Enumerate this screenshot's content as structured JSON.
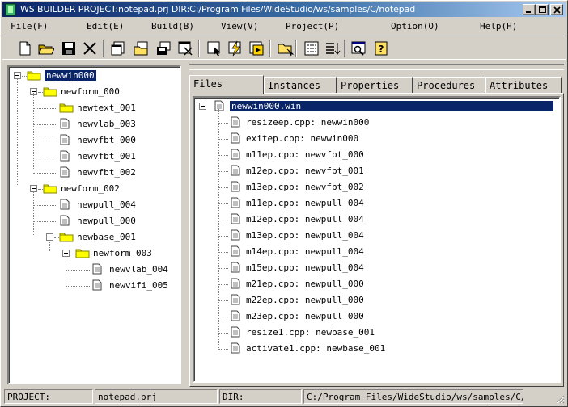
{
  "window": {
    "title": "WS BUILDER PROJECT:notepad.prj DIR:C:/Program Files/WideStudio/ws/samples/C/notepad"
  },
  "menu": [
    {
      "label": "File(F)"
    },
    {
      "label": "Edit(E)"
    },
    {
      "label": "Build(B)"
    },
    {
      "label": "View(V)"
    },
    {
      "label": "Project(P)"
    },
    {
      "label": "Option(O)"
    },
    {
      "label": "Help(H)"
    }
  ],
  "tree": {
    "items": [
      {
        "label": "newwin000",
        "type": "folder",
        "level": 0,
        "selected": true
      },
      {
        "label": "newform_000",
        "type": "folder",
        "level": 1
      },
      {
        "label": "newtext_001",
        "type": "folder",
        "level": 2
      },
      {
        "label": "newvlab_003",
        "type": "file",
        "level": 2
      },
      {
        "label": "newvfbt_000",
        "type": "file",
        "level": 2
      },
      {
        "label": "newvfbt_001",
        "type": "file",
        "level": 2
      },
      {
        "label": "newvfbt_002",
        "type": "file",
        "level": 2
      },
      {
        "label": "newform_002",
        "type": "folder",
        "level": 1
      },
      {
        "label": "newpull_004",
        "type": "file",
        "level": 2
      },
      {
        "label": "newpull_000",
        "type": "file",
        "level": 2
      },
      {
        "label": "newbase_001",
        "type": "folder",
        "level": 2
      },
      {
        "label": "newform_003",
        "type": "folder",
        "level": 3
      },
      {
        "label": "newvlab_004",
        "type": "file",
        "level": 4
      },
      {
        "label": "newvifi_005",
        "type": "file",
        "level": 4
      }
    ]
  },
  "tabs": [
    {
      "label": "Files",
      "active": true
    },
    {
      "label": "Instances"
    },
    {
      "label": "Properties"
    },
    {
      "label": "Procedures"
    },
    {
      "label": "Attributes"
    }
  ],
  "files": {
    "root": "newwin000.win",
    "items": [
      "resizeep.cpp: newwin000",
      "exitep.cpp: newwin000",
      "m11ep.cpp: newvfbt_000",
      "m12ep.cpp: newvfbt_001",
      "m13ep.cpp: newvfbt_002",
      "m11ep.cpp: newpull_004",
      "m12ep.cpp: newpull_004",
      "m13ep.cpp: newpull_004",
      "m14ep.cpp: newpull_004",
      "m15ep.cpp: newpull_004",
      "m21ep.cpp: newpull_000",
      "m22ep.cpp: newpull_000",
      "m23ep.cpp: newpull_000",
      "resize1.cpp: newbase_001",
      "activate1.cpp: newbase_001"
    ]
  },
  "status": {
    "project_label": "PROJECT:",
    "project_value": "notepad.prj",
    "dir_label": "DIR:",
    "dir_value": "C:/Program Files/WideStudio/ws/samples/C/note"
  },
  "colors": {
    "selection": "#0a246a",
    "folder": "#ffff00",
    "face": "#d4d0c8"
  },
  "icons": {
    "toolbar": [
      "new-file-icon",
      "open-folder-icon",
      "save-disk-icon",
      "cut-scissors-icon",
      "new-window-icon",
      "open-window-icon",
      "save-window-icon",
      "close-window-icon",
      "select-icon",
      "build-icon",
      "run-icon",
      "folder-move-icon",
      "grid-icon",
      "list-icon",
      "find-icon",
      "help-icon"
    ]
  }
}
